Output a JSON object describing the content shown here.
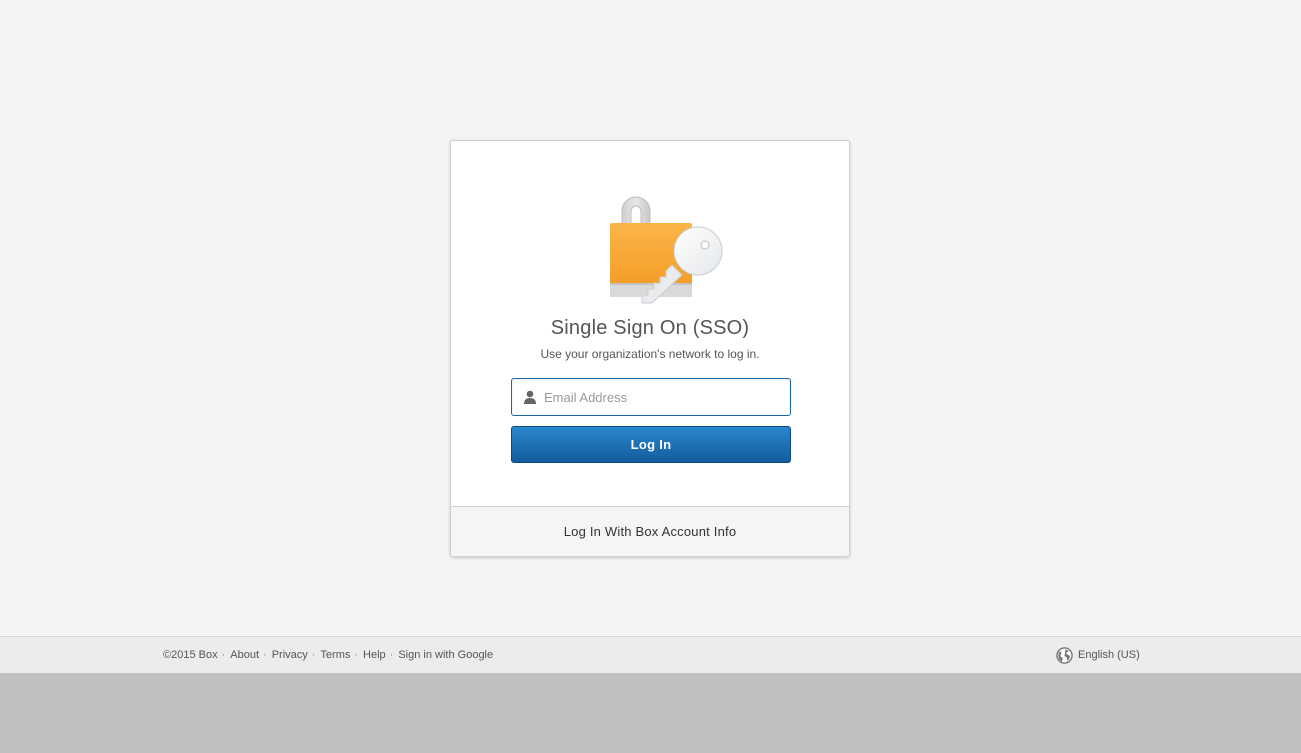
{
  "login": {
    "title": "Single Sign On (SSO)",
    "subtitle": "Use your organization's network to log in.",
    "email_placeholder": "Email Address",
    "email_value": "",
    "login_button": "Log In",
    "alt_login_link": "Log In With Box Account Info"
  },
  "footer": {
    "copyright": "©2015 Box",
    "links": [
      "About",
      "Privacy",
      "Terms",
      "Help",
      "Sign in with Google"
    ],
    "separator": "·",
    "language": "English (US)"
  },
  "icons": {
    "hero": "lock-key-icon",
    "email": "user-icon",
    "language": "globe-icon"
  },
  "colors": {
    "accent": "#1a67a5",
    "button_top": "#2a86cc",
    "button_bottom": "#135d9d",
    "lock_body": "#f5a93a",
    "background": "#f4f4f4"
  }
}
